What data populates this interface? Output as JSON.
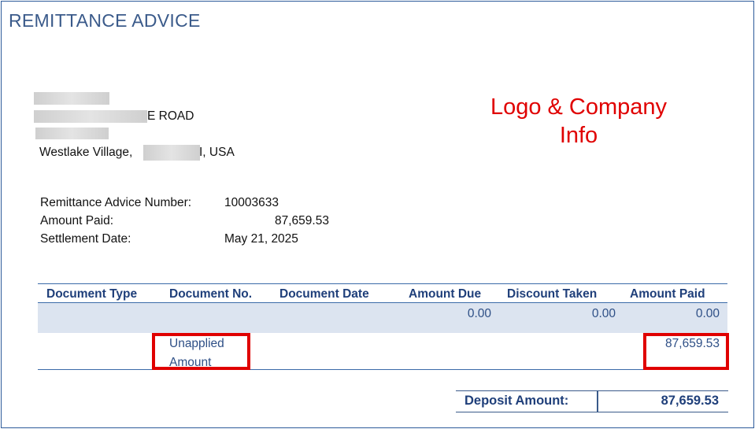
{
  "header": {
    "title": "REMITTANCE ADVICE"
  },
  "address": {
    "line2_suffix": "E ROAD",
    "city_prefix": "Westlake Village,",
    "city_suffix": "I, USA"
  },
  "annotation": {
    "logo_note": "Logo & Company Info"
  },
  "remittance": {
    "number_label": "Remittance Advice Number:",
    "number_value": "10003633",
    "amount_label": "Amount Paid:",
    "amount_value": "87,659.53",
    "date_label": "Settlement Date:",
    "date_value": "May 21, 2025"
  },
  "table": {
    "columns": [
      "Document Type",
      "Document No.",
      "Document Date",
      "Amount Due",
      "Discount Taken",
      "Amount Paid"
    ],
    "row1": {
      "amount_due": "0.00",
      "discount_taken": "0.00",
      "amount_paid": "0.00"
    },
    "row2": {
      "document_no_line1": "Unapplied",
      "document_no_line2": "Amount",
      "amount_paid": "87,659.53"
    }
  },
  "deposit": {
    "label": "Deposit Amount:",
    "value": "87,659.53"
  },
  "colors": {
    "accent": "#1f3f7a",
    "annotation": "#e00000",
    "row_shade": "#dce4f0"
  }
}
